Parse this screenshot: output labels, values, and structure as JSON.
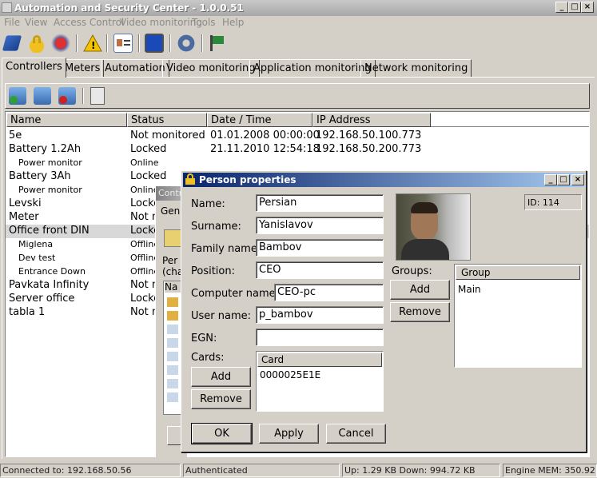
{
  "window": {
    "title": "Automation and Security Center - 1.0.0.51",
    "min": "_",
    "max": "□",
    "close": "×"
  },
  "menu": [
    "File",
    "View",
    "Access Control",
    "Video monitoring",
    "Tools",
    "Help"
  ],
  "toolbar_icons": [
    "network-connect-icon",
    "lock-icon",
    "alarm-icon",
    "warning-icon",
    "person-card-icon",
    "monitor-icon",
    "settings-gear-icon",
    "exit-flag-icon"
  ],
  "tabs": [
    "Controllers",
    "Meters",
    "Automation",
    "Video monitoring",
    "Application monitoring",
    "Network monitoring"
  ],
  "sub_toolbar_icons": [
    "add-controller-icon",
    "edit-controller-icon",
    "delete-controller-icon",
    "clipboard-icon"
  ],
  "table": {
    "columns": [
      "Name",
      "Status",
      "Date / Time",
      "IP Address"
    ],
    "rows": [
      {
        "name": "5e",
        "status": "Not monitored",
        "datetime": "01.01.2008 00:00:00",
        "ip": "192.168.50.100.773",
        "sub": false
      },
      {
        "name": "Battery 1.2Ah",
        "status": "Locked",
        "datetime": "21.11.2010 12:54:18",
        "ip": "192.168.50.200.773",
        "sub": false
      },
      {
        "name": "Power monitor",
        "status": "Online",
        "datetime": "",
        "ip": "",
        "sub": true
      },
      {
        "name": "Battery 3Ah",
        "status": "Locked",
        "datetime": "",
        "ip": "",
        "sub": false
      },
      {
        "name": "Power monitor",
        "status": "Online",
        "datetime": "",
        "ip": "",
        "sub": true
      },
      {
        "name": "Levski",
        "status": "Locke",
        "datetime": "",
        "ip": "",
        "sub": false
      },
      {
        "name": "Meter",
        "status": "Not m",
        "datetime": "",
        "ip": "",
        "sub": false
      },
      {
        "name": "Office front DIN",
        "status": "Locke",
        "datetime": "",
        "ip": "",
        "sub": false
      },
      {
        "name": "Miglena",
        "status": "Offline",
        "datetime": "",
        "ip": "",
        "sub": true
      },
      {
        "name": "Dev test",
        "status": "Offline",
        "datetime": "",
        "ip": "",
        "sub": true
      },
      {
        "name": "Entrance Down",
        "status": "Offline",
        "datetime": "",
        "ip": "",
        "sub": true
      },
      {
        "name": "Pavkata Infinity",
        "status": "Not m",
        "datetime": "",
        "ip": "",
        "sub": false
      },
      {
        "name": "Server office",
        "status": "Locke",
        "datetime": "",
        "ip": "",
        "sub": false
      },
      {
        "name": "tabla 1",
        "status": "Not m",
        "datetime": "",
        "ip": "",
        "sub": false
      }
    ]
  },
  "background_window": {
    "title": "Contr",
    "tab": "Gen",
    "label1": "Per",
    "label2": "(cha",
    "col": "Na"
  },
  "dialog": {
    "title": "Person properties",
    "id_label": "ID: 114",
    "fields": [
      {
        "label": "Name:",
        "value": "Persian"
      },
      {
        "label": "Surname:",
        "value": "Yanislavov"
      },
      {
        "label": "Family name:",
        "value": "Bambov"
      },
      {
        "label": "Position:",
        "value": "CEO"
      },
      {
        "label": "Computer name:",
        "value": "CEO-pc"
      },
      {
        "label": "User name:",
        "value": "p_bambov"
      },
      {
        "label": "EGN:",
        "value": ""
      }
    ],
    "cards_label": "Cards:",
    "cards_header": "Card",
    "cards": [
      "0000025E1E"
    ],
    "groups_label": "Groups:",
    "groups_header": "Group",
    "groups": [
      "Main"
    ],
    "add": "Add",
    "remove": "Remove",
    "ok": "OK",
    "apply": "Apply",
    "cancel": "Cancel"
  },
  "status": {
    "connected": "Connected to: 192.168.50.56",
    "auth": "Authenticated",
    "traffic": "Up: 1.29 KB Down: 994.72 KB",
    "engine": "Engine MEM: 350.92"
  }
}
